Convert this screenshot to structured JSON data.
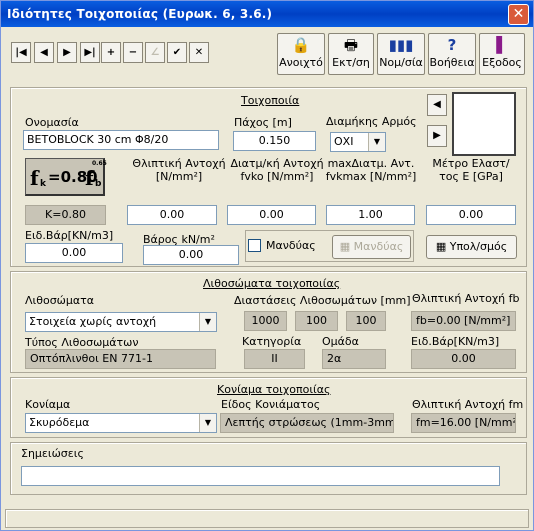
{
  "window": {
    "title": "Ιδιότητες Τοιχοποιίας (Ευρωκ. 6, 3.6.)",
    "close": "✕"
  },
  "nav": {
    "first": "|◀",
    "prev": "◀",
    "next": "▶",
    "last": "▶|",
    "add": "+",
    "remove": "−",
    "edit": "∠",
    "ok": "✔",
    "cancel": "✕"
  },
  "toolbar": {
    "open": {
      "label": "Ανοιχτό",
      "icon": "lock-icon"
    },
    "print": {
      "label": "Εκτ/ση",
      "icon": "printer-icon"
    },
    "norms": {
      "label": "Νομ/σία",
      "icon": "books-icon"
    },
    "help": {
      "label": "Βοήθεια",
      "icon": "question-icon"
    },
    "exit": {
      "label": "Εξοδος",
      "icon": "exit-door-icon"
    }
  },
  "masonry": {
    "header": "Τοιχοποιία",
    "name_label": "Ονομασία",
    "name_value": "BETOBLOCK 30 cm Φ8/20",
    "thickness_label": "Πάχος [m]",
    "thickness_value": "0.150",
    "joint_label": "Διαμήκης Αρμός",
    "joint_value": "ΟΧΙ",
    "formula_main": "f",
    "formula_sub": "k",
    "formula_eq": "=0.80",
    "formula_f": "f",
    "formula_sub2": "b",
    "formula_exp": "0.65",
    "k_value": "K=0.80",
    "compressive_label": "Θλιπτική Αντοχή [N/mm²]",
    "compressive_value": "0.00",
    "shear_label": "Διατμ/κή Αντοχή fvko [N/mm²]",
    "shear_value": "0.00",
    "maxshear_label": "maxΔιατμ. Αντ. fvkmax [N/mm²]",
    "maxshear_value": "1.00",
    "elastic_label": "Μέτρο Ελαστ/τος E [GPa]",
    "elastic_value": "0.00",
    "unitweight_label": "Ειδ.Βάρ[KN/m3]",
    "unitweight_value": "0.00",
    "weight_label": "Βάρος kN/m²",
    "weight_value": "0.00",
    "jacket_check": "Μανδύας",
    "jacket_btn": "Μανδύας",
    "calc_btn": "Υπολ/σμός"
  },
  "units": {
    "header": "Λιθοσώματα τοιχοποιίας",
    "units_label": "Λιθοσώματα",
    "units_value": "Στοιχεία χωρίς αντοχή",
    "dims_label": "Διαστάσεις Λιθοσωμάτων [mm]",
    "dims": [
      "1000",
      "100",
      "100"
    ],
    "fb_label": "Θλιπτική Αντοχή fb",
    "fb_value": "fb=0.00 [N/mm²]",
    "type_label": "Τύπος Λιθοσωμάτων",
    "type_value": "Οπτόπλινθοι EN 771-1",
    "category_label": "Κατηγορία",
    "category_value": "II",
    "group_label": "Ομάδα",
    "group_value": "2α",
    "uw_label": "Ειδ.Βάρ[KN/m3]",
    "uw_value": "0.00"
  },
  "mortar": {
    "header": "Κονίαμα τοιχοποιίας",
    "mortar_label": "Κονίαμα",
    "mortar_value": "Σκυρόδεμα",
    "kind_label": "Είδος Κονιάματος",
    "kind_value": "Λεπτής στρώσεως (1mm-3mm)",
    "fm_label": "Θλιπτική Αντοχή fm",
    "fm_value": "fm=16.00 [N/mm²]"
  },
  "notes": {
    "label": "Σημειώσεις",
    "value": ""
  },
  "preview": {
    "left": "◀",
    "right": "▶"
  }
}
